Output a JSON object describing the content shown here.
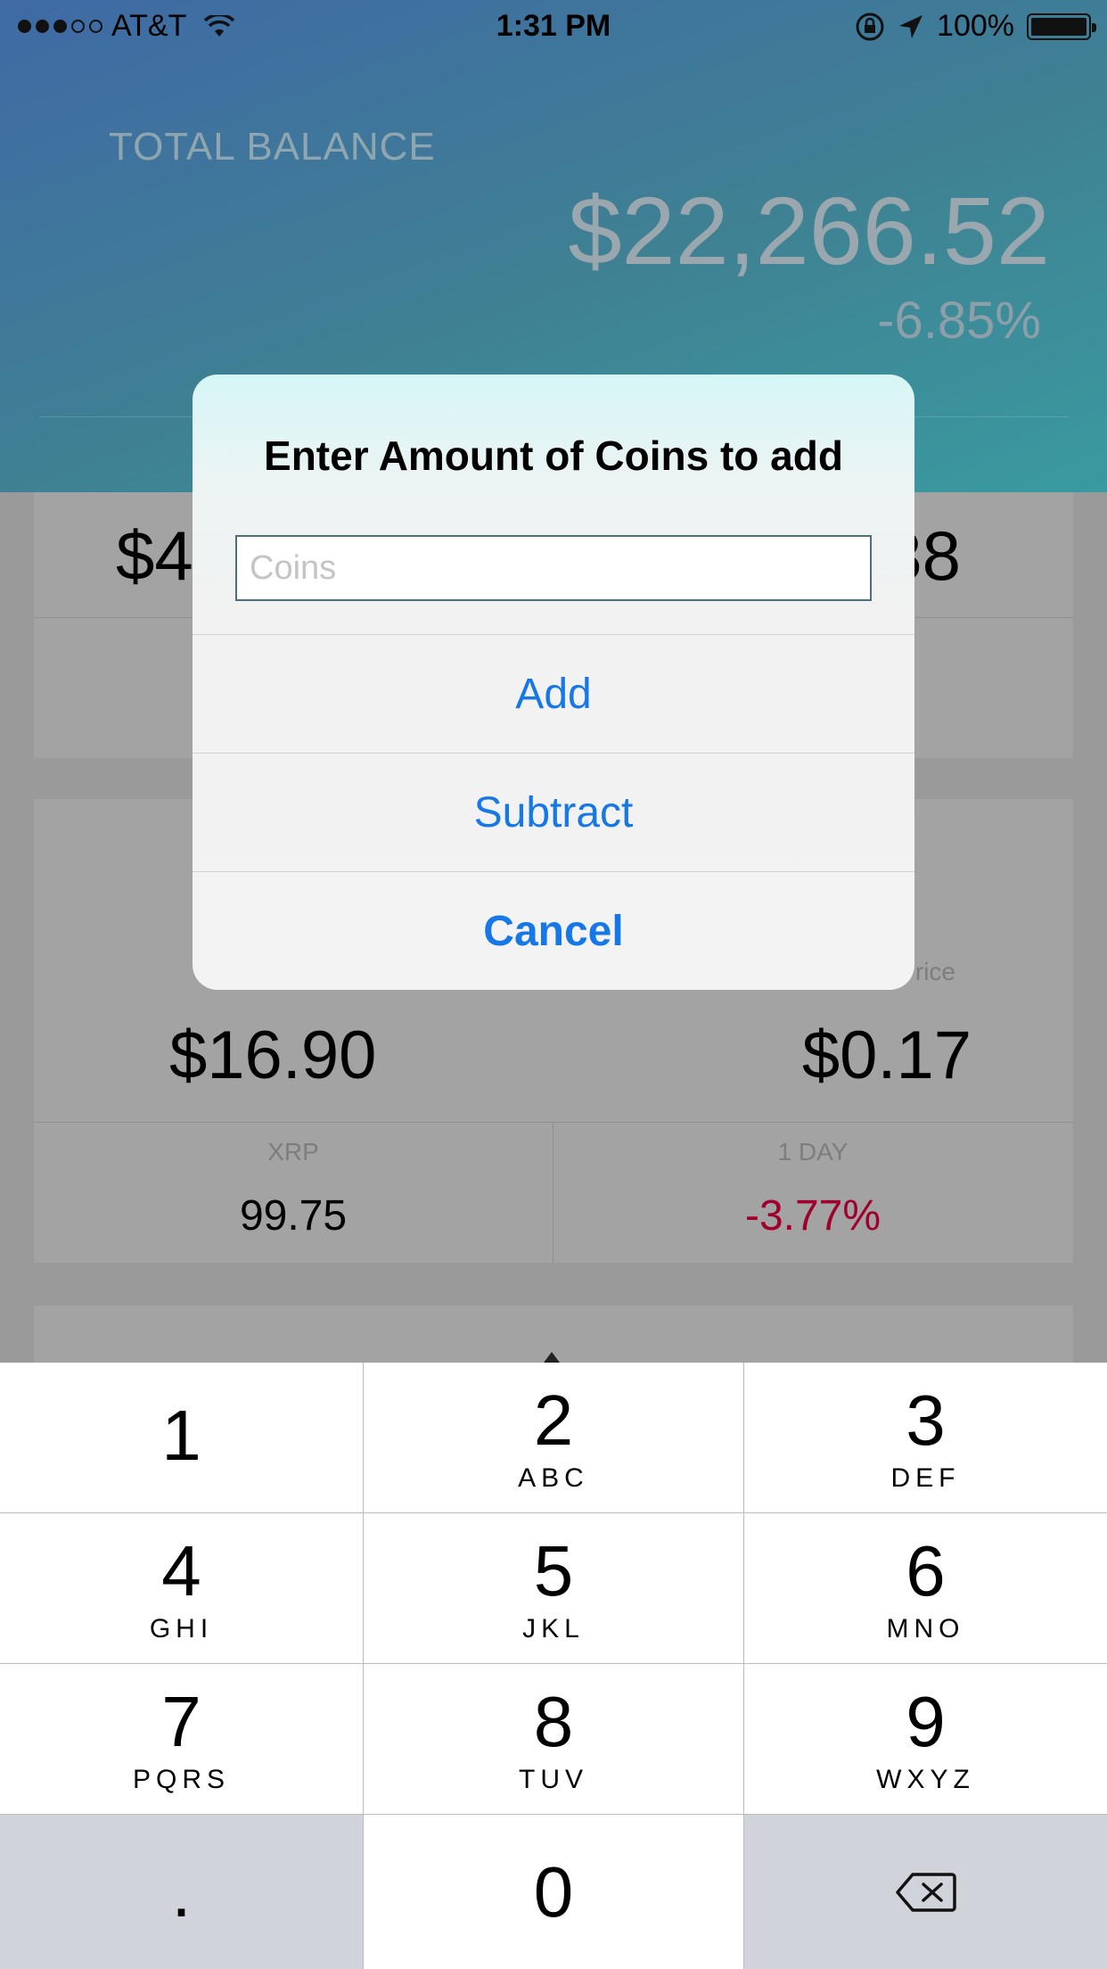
{
  "status_bar": {
    "carrier": "AT&T",
    "time": "1:31 PM",
    "battery": "100%"
  },
  "header": {
    "total_label": "TOTAL BALANCE",
    "total_value": "$22,266.52",
    "total_change": "-6.85%"
  },
  "cards": {
    "card1_left_value": "$4",
    "card1_right_value": "38",
    "card2_price_label": "rice",
    "card2_left_value": "$16.90",
    "card2_right_value": "$0.17",
    "card2_sub_left_label": "XRP",
    "card2_sub_left_value": "99.75",
    "card2_sub_right_label": "1 DAY",
    "card2_sub_right_value": "-3.77%"
  },
  "alert": {
    "title": "Enter Amount of Coins to add",
    "input_placeholder": "Coins",
    "input_value": "",
    "buttons": {
      "add": "Add",
      "subtract": "Subtract",
      "cancel": "Cancel"
    }
  },
  "keypad": {
    "keys": [
      {
        "digit": "1",
        "letters": ""
      },
      {
        "digit": "2",
        "letters": "ABC"
      },
      {
        "digit": "3",
        "letters": "DEF"
      },
      {
        "digit": "4",
        "letters": "GHI"
      },
      {
        "digit": "5",
        "letters": "JKL"
      },
      {
        "digit": "6",
        "letters": "MNO"
      },
      {
        "digit": "7",
        "letters": "PQRS"
      },
      {
        "digit": "8",
        "letters": "TUV"
      },
      {
        "digit": "9",
        "letters": "WXYZ"
      },
      {
        "digit": ".",
        "letters": ""
      },
      {
        "digit": "0",
        "letters": ""
      }
    ],
    "delete_icon": "backspace-icon"
  },
  "colors": {
    "accent": "#1678e8",
    "negative": "#a0002b",
    "header_gradient_start": "#3f6aa5",
    "header_gradient_end": "#3a9aa0"
  }
}
